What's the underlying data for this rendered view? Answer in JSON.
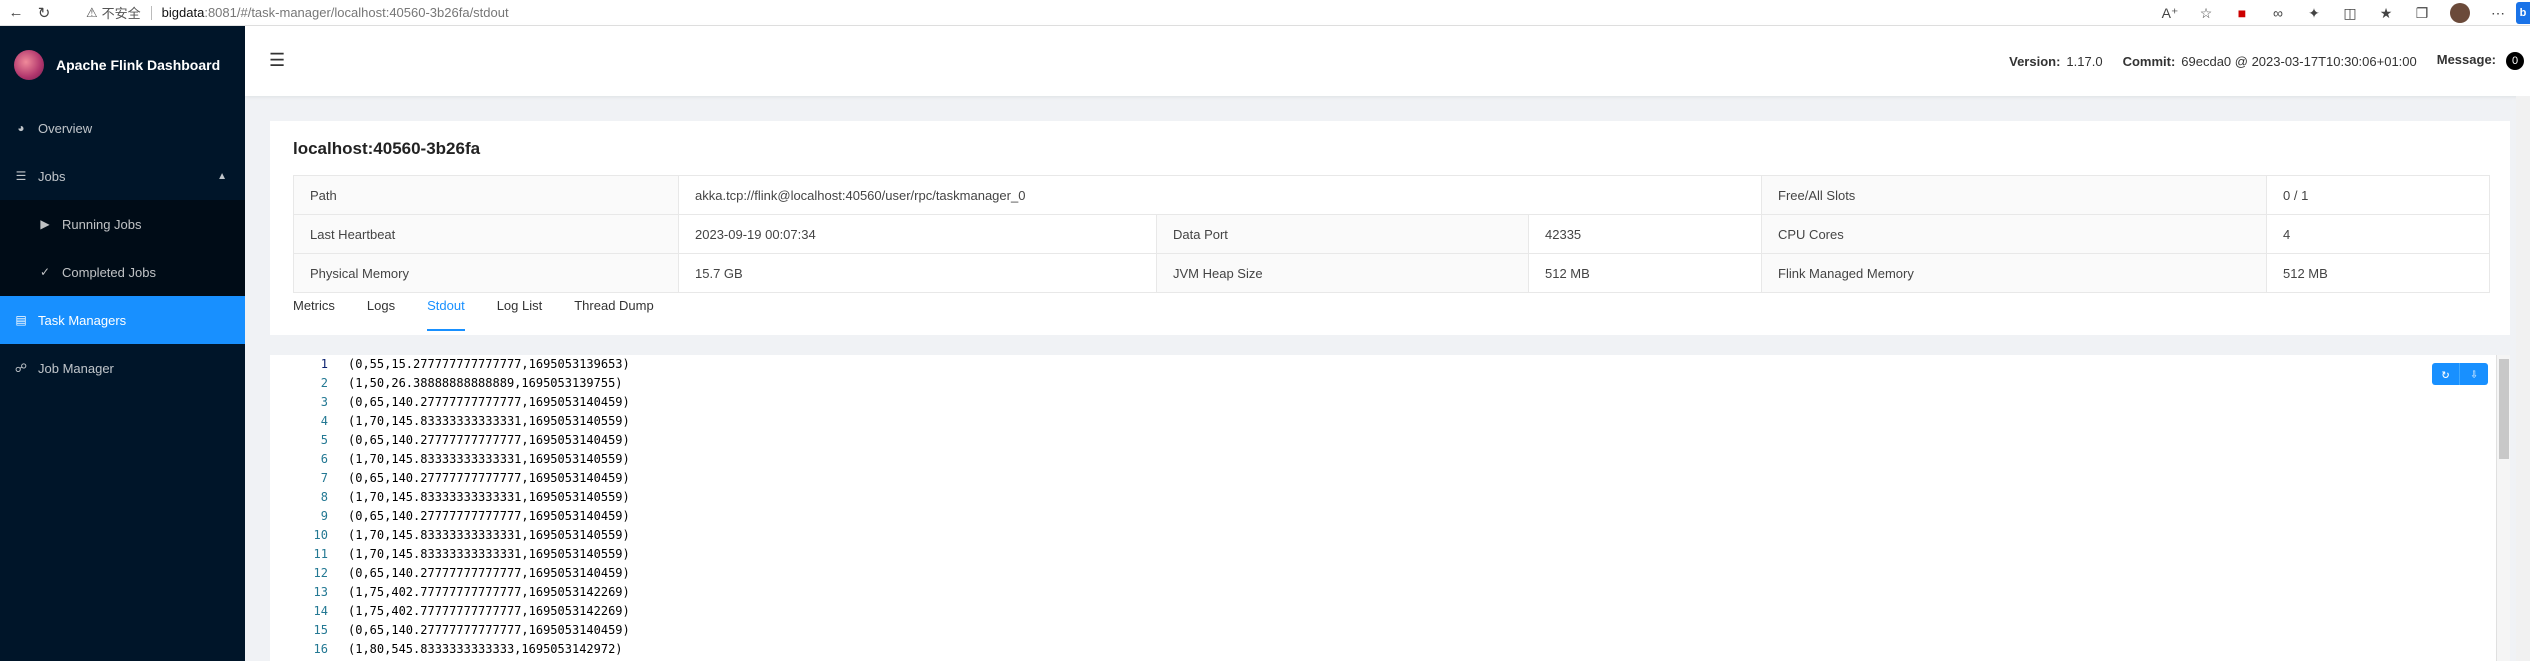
{
  "browser": {
    "back_icon": "arrow-left-icon",
    "reload_icon": "reload-icon",
    "warning_icon": "warning-triangle-icon",
    "insecure_label": "不安全",
    "url_host": "bigdata",
    "url_path": ":8081/#/task-manager/localhost:40560-3b26fa/stdout"
  },
  "sidebar": {
    "app_title": "Apache Flink Dashboard",
    "items": [
      {
        "label": "Overview",
        "icon": "dashboard-icon"
      },
      {
        "label": "Jobs",
        "icon": "list-icon"
      },
      {
        "label": "Running Jobs",
        "icon": "play-circle-icon"
      },
      {
        "label": "Completed Jobs",
        "icon": "check-circle-icon"
      },
      {
        "label": "Task Managers",
        "icon": "schedule-icon"
      },
      {
        "label": "Job Manager",
        "icon": "cluster-icon"
      }
    ]
  },
  "header": {
    "version_label": "Version:",
    "version_value": "1.17.0",
    "commit_label": "Commit:",
    "commit_value": "69ecda0 @ 2023-03-17T10:30:06+01:00",
    "message_label": "Message:",
    "message_count": "0"
  },
  "page": {
    "title": "localhost:40560-3b26fa",
    "info": {
      "path_label": "Path",
      "path_value": "akka.tcp://flink@localhost:40560/user/rpc/taskmanager_0",
      "free_slots_label": "Free/All Slots",
      "free_slots_value": "0 / 1",
      "heartbeat_label": "Last Heartbeat",
      "heartbeat_value": "2023-09-19 00:07:34",
      "data_port_label": "Data Port",
      "data_port_value": "42335",
      "cpu_label": "CPU Cores",
      "cpu_value": "4",
      "memory_label": "Physical Memory",
      "memory_value": "15.7 GB",
      "jvm_label": "JVM Heap Size",
      "jvm_value": "512 MB",
      "managed_label": "Flink Managed Memory",
      "managed_value": "512 MB"
    },
    "tabs": [
      "Metrics",
      "Logs",
      "Stdout",
      "Log List",
      "Thread Dump"
    ],
    "active_tab": "Stdout"
  },
  "stdout": {
    "lines": [
      {
        "n": "1",
        "text": "(0,55,15.277777777777777,1695053139653)"
      },
      {
        "n": "2",
        "text": "(1,50,26.38888888888889,1695053139755)"
      },
      {
        "n": "3",
        "text": "(0,65,140.27777777777777,1695053140459)"
      },
      {
        "n": "4",
        "text": "(1,70,145.83333333333331,1695053140559)"
      },
      {
        "n": "5",
        "text": "(0,65,140.27777777777777,1695053140459)"
      },
      {
        "n": "6",
        "text": "(1,70,145.83333333333331,1695053140559)"
      },
      {
        "n": "7",
        "text": "(0,65,140.27777777777777,1695053140459)"
      },
      {
        "n": "8",
        "text": "(1,70,145.83333333333331,1695053140559)"
      },
      {
        "n": "9",
        "text": "(0,65,140.27777777777777,1695053140459)"
      },
      {
        "n": "10",
        "text": "(1,70,145.83333333333331,1695053140559)"
      },
      {
        "n": "11",
        "text": "(1,70,145.83333333333331,1695053140559)"
      },
      {
        "n": "12",
        "text": "(0,65,140.27777777777777,1695053140459)"
      },
      {
        "n": "13",
        "text": "(1,75,402.77777777777777,1695053142269)"
      },
      {
        "n": "14",
        "text": "(1,75,402.77777777777777,1695053142269)"
      },
      {
        "n": "15",
        "text": "(0,65,140.27777777777777,1695053140459)"
      },
      {
        "n": "16",
        "text": "(1,80,545.8333333333333,1695053142972)"
      }
    ],
    "refresh_icon": "refresh-icon",
    "download_icon": "download-icon"
  }
}
